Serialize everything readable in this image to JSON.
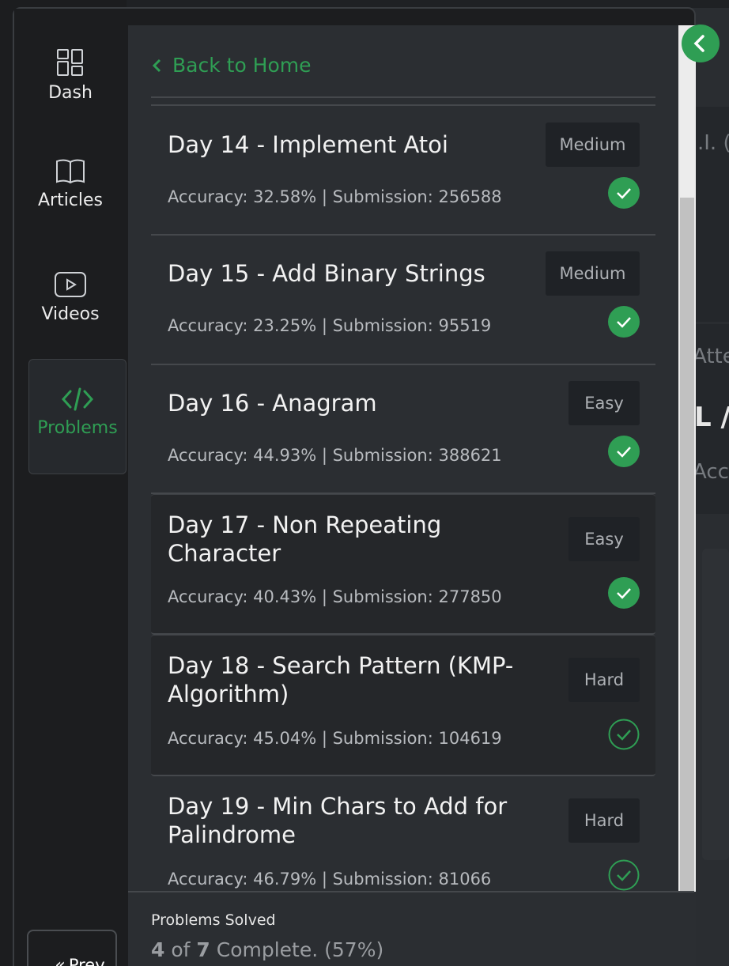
{
  "nav": {
    "items": [
      {
        "label": "Dash",
        "icon": "dashboard-icon"
      },
      {
        "label": "Articles",
        "icon": "book-icon"
      },
      {
        "label": "Videos",
        "icon": "video-icon"
      },
      {
        "label": "Problems",
        "icon": "code-icon",
        "active": true
      }
    ],
    "prev_label": "Prev"
  },
  "drawer": {
    "back_label": "Back to Home",
    "problems": [
      {
        "title": "Day 14 - Implement Atoi",
        "meta": "Accuracy: 32.58% | Submission: 256588",
        "difficulty": "Medium",
        "status": "solved"
      },
      {
        "title": "Day 15 - Add Binary Strings",
        "meta": "Accuracy: 23.25% | Submission: 95519",
        "difficulty": "Medium",
        "status": "solved"
      },
      {
        "title": "Day 16 - Anagram",
        "meta": "Accuracy: 44.93% | Submission: 388621",
        "difficulty": "Easy",
        "status": "solved"
      },
      {
        "title": "Day 17 - Non Repeating Character",
        "meta": "Accuracy: 40.43% | Submission: 277850",
        "difficulty": "Easy",
        "status": "solved"
      },
      {
        "title": "Day 18 - Search Pattern (KMP-Algorithm)",
        "meta": "Accuracy: 45.04% | Submission: 104619",
        "difficulty": "Hard",
        "status": "unsolved"
      },
      {
        "title": "Day 19 - Min Chars to Add for Palindrome",
        "meta": "Accuracy: 46.79% | Submission: 81066",
        "difficulty": "Hard",
        "status": "unsolved"
      }
    ]
  },
  "footer": {
    "label": "Problems Solved",
    "solved": "4",
    "of_text": " of ",
    "total": "7",
    "complete_text": " Complete. (57%)"
  },
  "background": {
    "frag1": ".I. (",
    "frag2": "Atte",
    "frag3": "L /",
    "frag4": "Accu"
  },
  "colors": {
    "accent": "#2f9e54",
    "panel": "#2b2e32",
    "dark_item": "#25272a"
  }
}
